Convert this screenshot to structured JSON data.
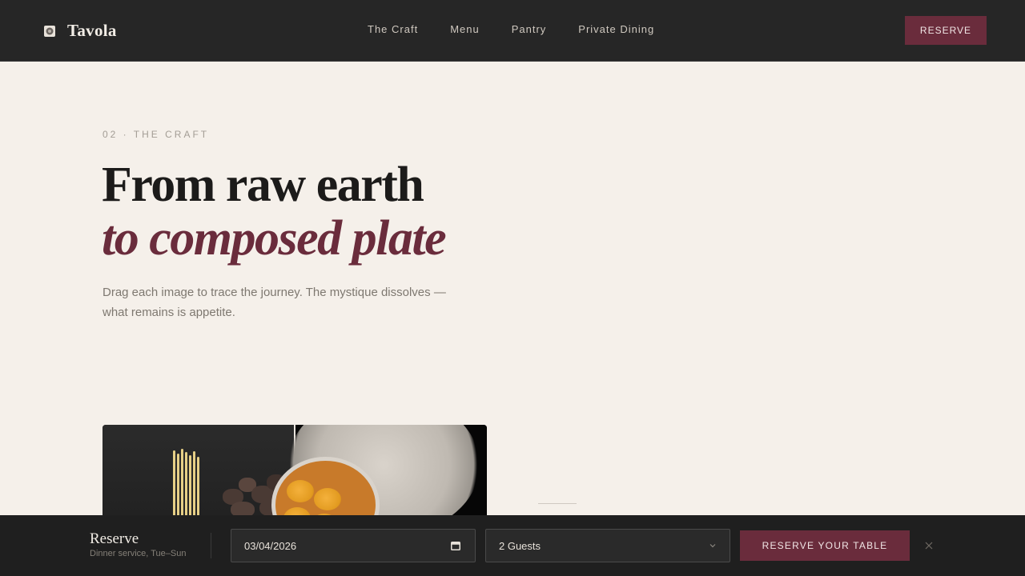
{
  "header": {
    "brand": "Tavola",
    "nav": [
      "The Craft",
      "Menu",
      "Pantry",
      "Private Dining"
    ],
    "reserve_label": "RESERVE"
  },
  "hero": {
    "eyebrow": "02 · THE CRAFT",
    "title_line1": "From raw earth",
    "title_line2": "to composed plate",
    "lede": "Drag each image to trace the journey. The mystique dissolves — what remains is appetite."
  },
  "reserve_bar": {
    "title": "Reserve",
    "subtitle": "Dinner service, Tue–Sun",
    "date_value": "03/04/2026",
    "guests_value": "2 Guests",
    "cta_label": "RESERVE YOUR TABLE"
  },
  "icons": {
    "brand": "brand-mark-icon",
    "calendar": "calendar-icon",
    "dropdown": "chevron-down-icon",
    "close": "close-icon"
  },
  "colors": {
    "accent": "#6a2c3c",
    "header_bg": "#262626",
    "page_bg": "#f5f0ea",
    "bar_bg": "#1f1f1f"
  }
}
